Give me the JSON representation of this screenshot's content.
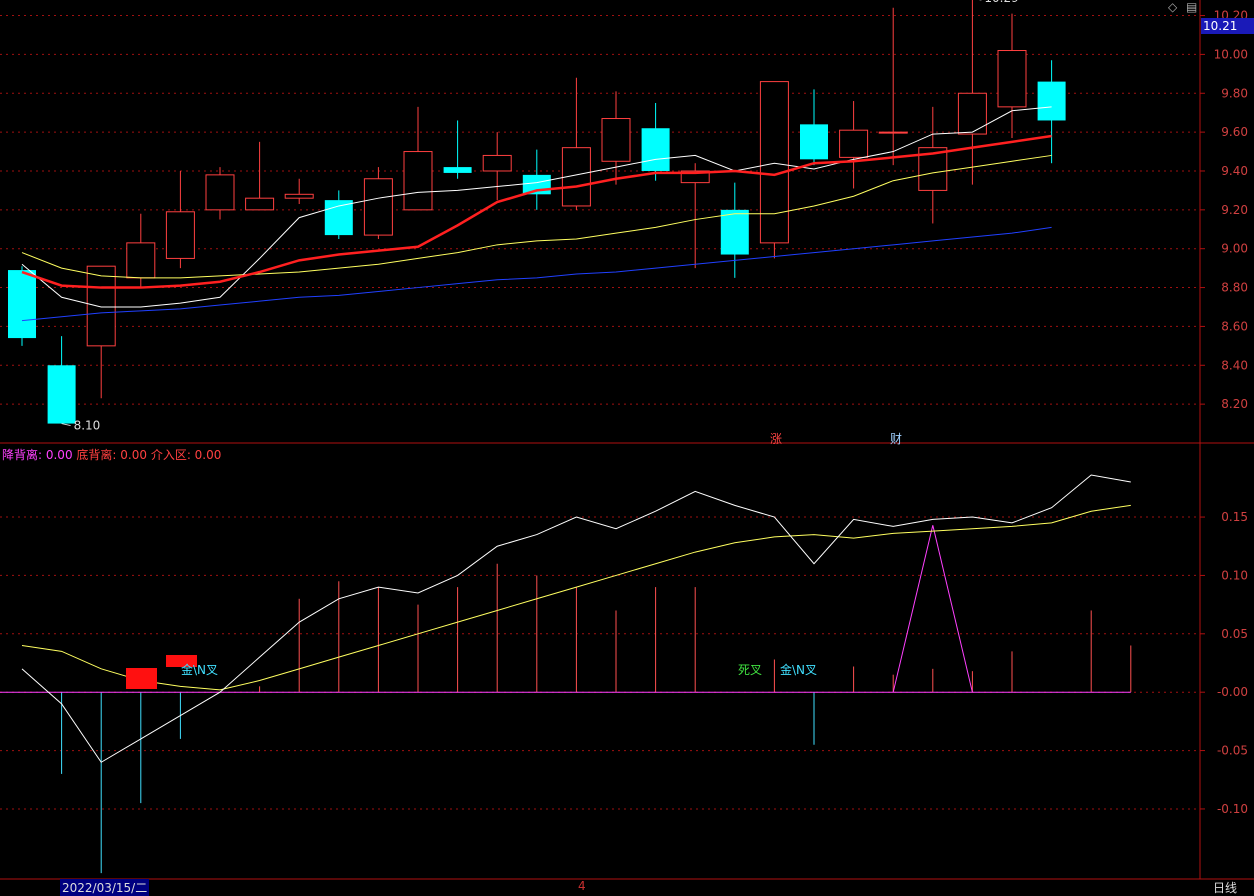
{
  "top_icons": {
    "diamond": "◇",
    "menu": "▤"
  },
  "current_price": "10.21",
  "markers": {
    "zhang": "涨",
    "cai": "财"
  },
  "legend": {
    "a": "降背离: 0.00",
    "b": "底背离: 0.00",
    "c": "介入区: 0.00"
  },
  "signals": [
    {
      "text": "金\\N叉",
      "color": "#40e0ff",
      "x": 181,
      "y": 661
    },
    {
      "text": "死叉",
      "color": "#40e040",
      "x": 738,
      "y": 661
    },
    {
      "text": "金\\N叉",
      "color": "#40e0ff",
      "x": 780,
      "y": 661
    }
  ],
  "bottom": {
    "date": "2022/03/15/二",
    "month_tick": "4",
    "period": "日线"
  },
  "colors": {
    "up": "#ff4040",
    "down": "#00ffff",
    "grid": "#a01010",
    "ma5": "#ffffff",
    "ma10": "#ff2020",
    "ma20": "#ffff60",
    "ma60": "#2040ff"
  },
  "chart_data": [
    {
      "type": "candlestick",
      "ylim": [
        8.0,
        10.28
      ],
      "yticks": [
        "10.20",
        "10.00",
        "9.80",
        "9.60",
        "9.40",
        "9.20",
        "9.00",
        "8.80",
        "8.60",
        "8.40",
        "8.20"
      ],
      "annotations": [
        {
          "text": "10.29",
          "value": 10.29,
          "index": 24
        },
        {
          "text": "8.10",
          "value": 8.1,
          "index": 1
        }
      ],
      "candles": [
        {
          "o": 8.89,
          "h": 8.91,
          "l": 8.5,
          "c": 8.54
        },
        {
          "o": 8.4,
          "h": 8.55,
          "l": 8.1,
          "c": 8.1
        },
        {
          "o": 8.5,
          "h": 8.91,
          "l": 8.23,
          "c": 8.91
        },
        {
          "o": 8.85,
          "h": 9.18,
          "l": 8.8,
          "c": 9.03
        },
        {
          "o": 8.95,
          "h": 9.4,
          "l": 8.9,
          "c": 9.19
        },
        {
          "o": 9.2,
          "h": 9.42,
          "l": 9.15,
          "c": 9.38
        },
        {
          "o": 9.2,
          "h": 9.55,
          "l": 9.2,
          "c": 9.26
        },
        {
          "o": 9.26,
          "h": 9.36,
          "l": 9.23,
          "c": 9.28
        },
        {
          "o": 9.25,
          "h": 9.3,
          "l": 9.05,
          "c": 9.07
        },
        {
          "o": 9.07,
          "h": 9.42,
          "l": 9.05,
          "c": 9.36
        },
        {
          "o": 9.2,
          "h": 9.73,
          "l": 9.2,
          "c": 9.5
        },
        {
          "o": 9.42,
          "h": 9.66,
          "l": 9.36,
          "c": 9.39
        },
        {
          "o": 9.4,
          "h": 9.6,
          "l": 9.25,
          "c": 9.48
        },
        {
          "o": 9.38,
          "h": 9.51,
          "l": 9.2,
          "c": 9.28
        },
        {
          "o": 9.22,
          "h": 9.88,
          "l": 9.2,
          "c": 9.52
        },
        {
          "o": 9.45,
          "h": 9.81,
          "l": 9.33,
          "c": 9.67
        },
        {
          "o": 9.62,
          "h": 9.75,
          "l": 9.35,
          "c": 9.4
        },
        {
          "o": 9.34,
          "h": 9.44,
          "l": 8.9,
          "c": 9.4
        },
        {
          "o": 9.2,
          "h": 9.34,
          "l": 8.85,
          "c": 8.97
        },
        {
          "o": 9.03,
          "h": 9.86,
          "l": 8.95,
          "c": 9.86
        },
        {
          "o": 9.64,
          "h": 9.82,
          "l": 9.43,
          "c": 9.46
        },
        {
          "o": 9.47,
          "h": 9.76,
          "l": 9.31,
          "c": 9.61
        },
        {
          "o": 9.6,
          "h": 10.24,
          "l": 9.43,
          "c": 9.6
        },
        {
          "o": 9.3,
          "h": 9.73,
          "l": 9.13,
          "c": 9.52
        },
        {
          "o": 9.59,
          "h": 10.29,
          "l": 9.33,
          "c": 9.8
        },
        {
          "o": 9.73,
          "h": 10.21,
          "l": 9.57,
          "c": 10.02
        },
        {
          "o": 9.86,
          "h": 9.97,
          "l": 9.44,
          "c": 9.66
        }
      ],
      "ma5": [
        8.92,
        8.75,
        8.7,
        8.7,
        8.72,
        8.75,
        8.95,
        9.16,
        9.22,
        9.26,
        9.29,
        9.3,
        9.32,
        9.34,
        9.38,
        9.42,
        9.46,
        9.48,
        9.4,
        9.44,
        9.41,
        9.46,
        9.5,
        9.59,
        9.6,
        9.71,
        9.73
      ],
      "ma10": [
        8.88,
        8.81,
        8.8,
        8.8,
        8.81,
        8.83,
        8.88,
        8.94,
        8.97,
        8.99,
        9.01,
        9.12,
        9.24,
        9.3,
        9.32,
        9.36,
        9.39,
        9.39,
        9.4,
        9.38,
        9.44,
        9.45,
        9.47,
        9.49,
        9.52,
        9.55,
        9.58
      ],
      "ma20": [
        8.98,
        8.9,
        8.86,
        8.85,
        8.85,
        8.86,
        8.87,
        8.88,
        8.9,
        8.92,
        8.95,
        8.98,
        9.02,
        9.04,
        9.05,
        9.08,
        9.11,
        9.15,
        9.18,
        9.18,
        9.22,
        9.27,
        9.35,
        9.39,
        9.42,
        9.45,
        9.48
      ],
      "ma60": [
        8.63,
        8.65,
        8.67,
        8.68,
        8.69,
        8.71,
        8.73,
        8.75,
        8.76,
        8.78,
        8.8,
        8.82,
        8.84,
        8.85,
        8.87,
        8.88,
        8.9,
        8.92,
        8.94,
        8.96,
        8.98,
        9.0,
        9.02,
        9.04,
        9.06,
        9.08,
        9.11
      ]
    },
    {
      "type": "indicator",
      "ylim": [
        -0.16,
        0.21
      ],
      "yticks": [
        "0.15",
        "0.10",
        "0.05",
        "-0.00",
        "-0.05",
        "-0.10"
      ],
      "line_white": [
        0.02,
        -0.01,
        -0.06,
        -0.04,
        -0.02,
        0.0,
        0.03,
        0.06,
        0.08,
        0.09,
        0.085,
        0.1,
        0.125,
        0.135,
        0.15,
        0.14,
        0.155,
        0.172,
        0.16,
        0.15,
        0.11,
        0.148,
        0.142,
        0.148,
        0.15,
        0.145,
        0.158,
        0.186,
        0.18
      ],
      "line_yellow": [
        0.04,
        0.035,
        0.02,
        0.01,
        0.005,
        0.002,
        0.01,
        0.02,
        0.03,
        0.04,
        0.05,
        0.06,
        0.07,
        0.08,
        0.09,
        0.1,
        0.11,
        0.12,
        0.128,
        0.133,
        0.135,
        0.132,
        0.136,
        0.138,
        0.14,
        0.142,
        0.145,
        0.155,
        0.16
      ],
      "bars": [
        0.0,
        -0.07,
        -0.155,
        -0.095,
        -0.04,
        0.0,
        0.005,
        0.08,
        0.095,
        0.09,
        0.075,
        0.09,
        0.11,
        0.1,
        0.09,
        0.07,
        0.09,
        0.09,
        0.0,
        0.028,
        -0.045,
        0.022,
        0.015,
        0.02,
        0.018,
        0.035,
        0.0,
        0.07,
        0.04
      ],
      "magenta_peak": {
        "start": 22,
        "peak": 23,
        "end": 24,
        "value": 0.143
      }
    }
  ]
}
